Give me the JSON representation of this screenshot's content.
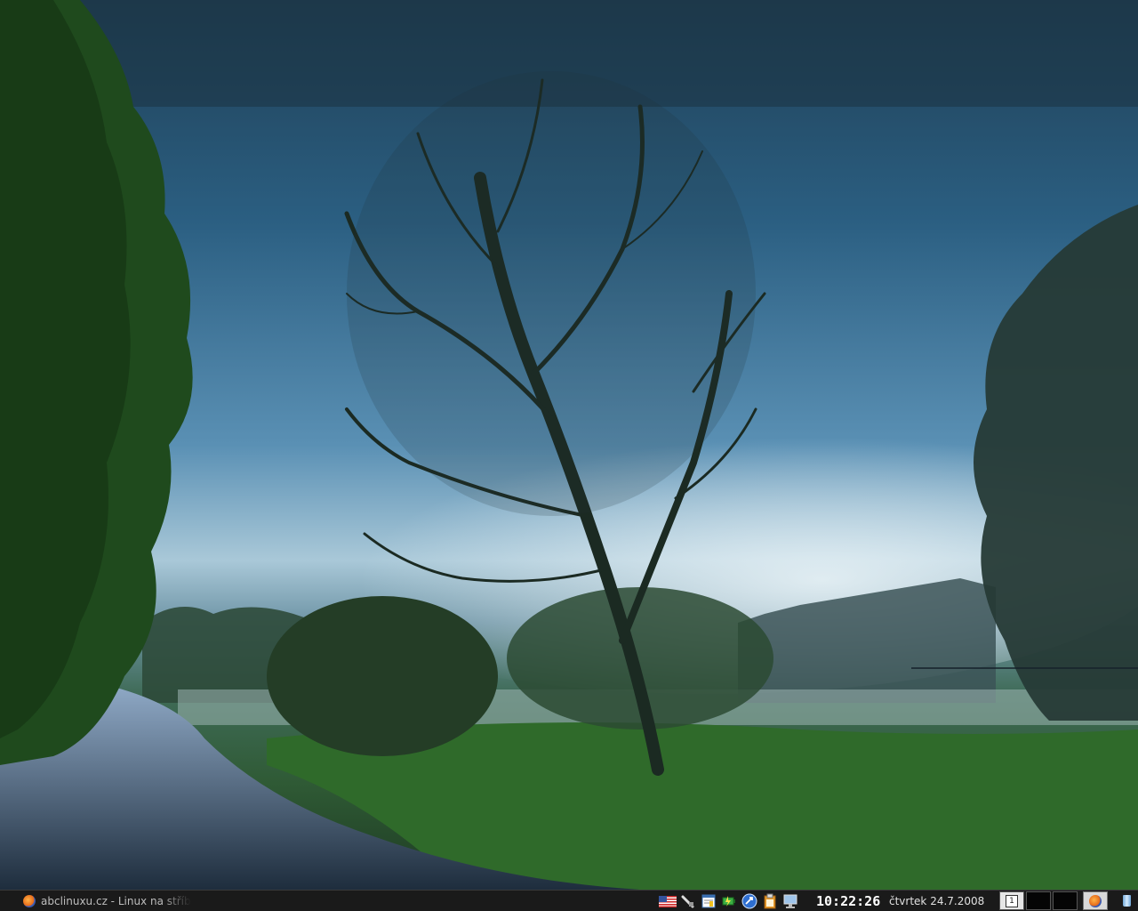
{
  "desktop": {
    "wallpaper": "misty river landscape with bare tree at dawn"
  },
  "taskbar": {
    "task": {
      "icon": "firefox-icon",
      "title": "abclinuxu.cz - Linux na stříb"
    },
    "tray": [
      {
        "name": "keyboard-layout-us-flag-icon"
      },
      {
        "name": "network-cable-icon"
      },
      {
        "name": "notes-icon"
      },
      {
        "name": "battery-power-icon"
      },
      {
        "name": "updates-icon"
      },
      {
        "name": "clipboard-icon"
      },
      {
        "name": "display-icon"
      }
    ],
    "clock": "10:22:26",
    "date": "čtvrtek  24.7.2008",
    "pager": {
      "workspaces": [
        "1",
        "",
        ""
      ],
      "active_index": 0
    },
    "browser_button_icon": "firefox-icon",
    "trash_icon": "trash-icon"
  }
}
